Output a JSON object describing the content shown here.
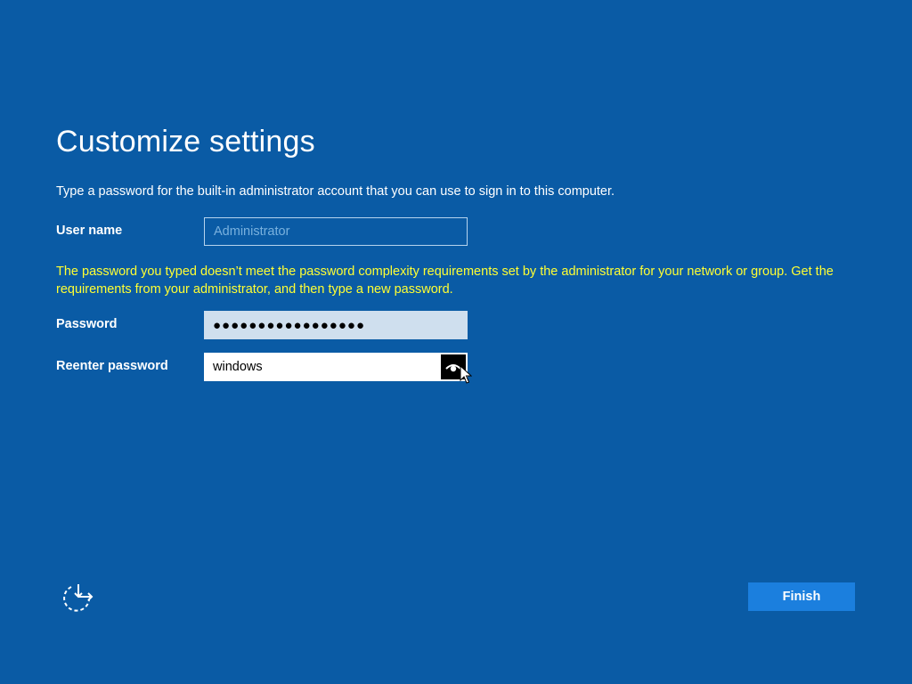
{
  "page": {
    "title": "Customize settings",
    "instructions": "Type a password for the built-in administrator account that you can use to sign in to this computer."
  },
  "form": {
    "username_label": "User name",
    "username_placeholder": "Administrator",
    "warning": "The password you typed doesn’t meet the password complexity requirements set by the administrator for your network or group. Get the requirements from your administrator, and then type a new password.",
    "password_label": "Password",
    "password_masked": "●●●●●●●●●●●●●●●●●",
    "reenter_label": "Reenter password",
    "reenter_value": "windows"
  },
  "icons": {
    "reveal": "eye-icon",
    "ease_of_access": "ease-of-access-icon"
  },
  "footer": {
    "finish_label": "Finish"
  },
  "colors": {
    "background": "#0a5ba5",
    "warning_text": "#ffff33",
    "button": "#1b7fde"
  }
}
